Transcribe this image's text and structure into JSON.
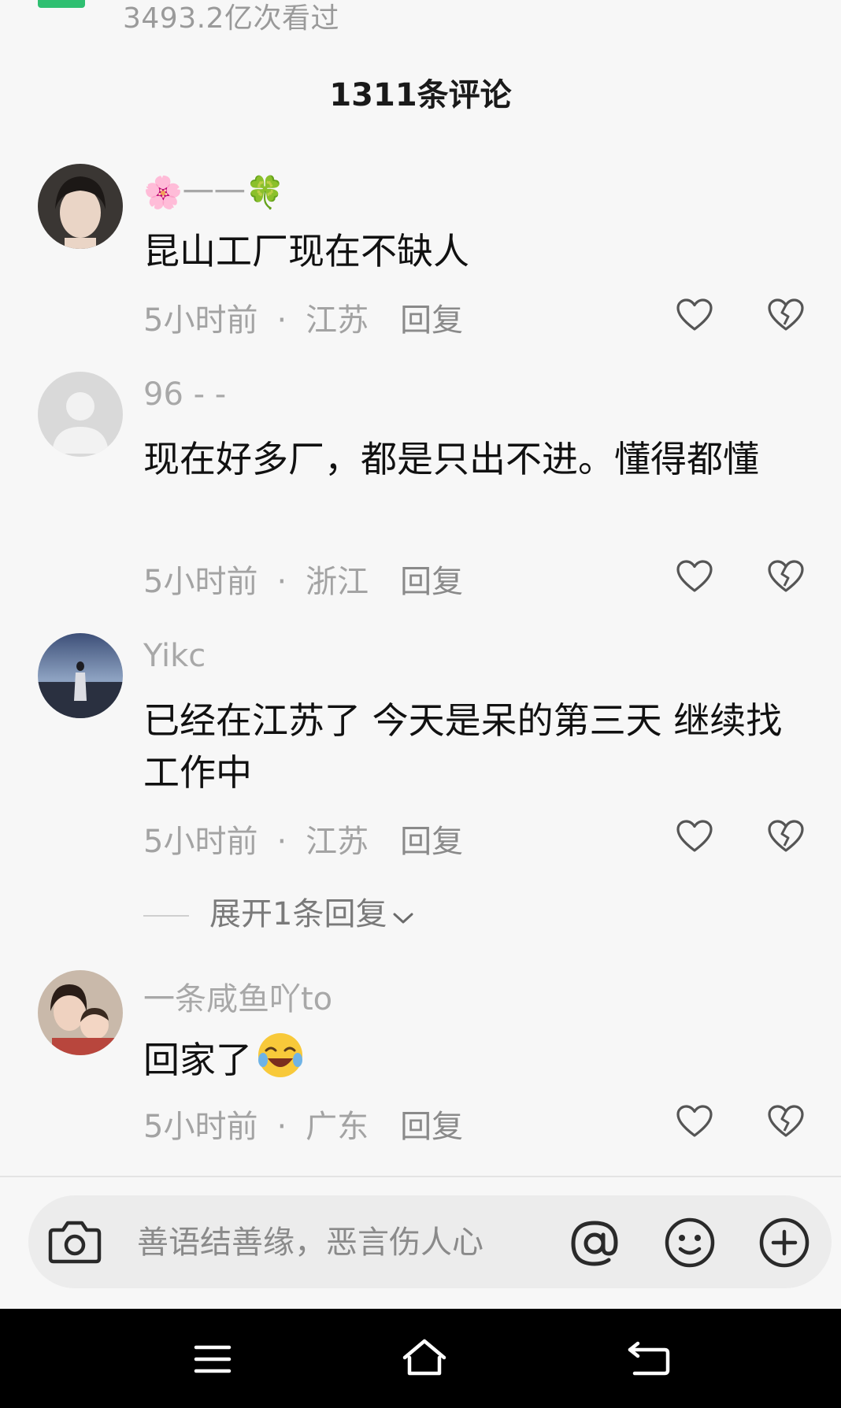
{
  "header": {
    "views": "3493.2亿次看过",
    "comments_title": "1311条评论"
  },
  "comments": [
    {
      "username": "🌸一一🍀",
      "text": "昆山工厂现在不缺人",
      "time": "5小时前",
      "dot": "·",
      "location": "江苏",
      "reply": "回复"
    },
    {
      "username": "96 -  -",
      "text": "现在好多厂，都是只出不进。懂得都懂",
      "time": "5小时前",
      "dot": "·",
      "location": "浙江",
      "reply": "回复"
    },
    {
      "username": "Yikc",
      "text": "已经在江苏了 今天是呆的第三天  继续找工作中",
      "time": "5小时前",
      "dot": "·",
      "location": "江苏",
      "reply": "回复"
    },
    {
      "username": "一条咸鱼吖to",
      "text": "回家了",
      "time": "5小时前",
      "dot": "·",
      "location": "广东",
      "reply": "回复"
    }
  ],
  "expand_replies": "展开1条回复",
  "input": {
    "placeholder": "善语结善缘，恶言伤人心"
  },
  "icons": {
    "like": "heart-icon",
    "dislike": "broken-heart-icon",
    "camera": "camera-icon",
    "at": "at-icon",
    "emoji": "smiley-icon",
    "plus": "plus-icon",
    "nav_menu": "menu-icon",
    "nav_home": "home-icon",
    "nav_back": "back-icon"
  },
  "colors": {
    "background": "#f7f7f7",
    "meta_text": "#a3a3a3",
    "badge": "#2fbf71",
    "navbar": "#000000"
  }
}
